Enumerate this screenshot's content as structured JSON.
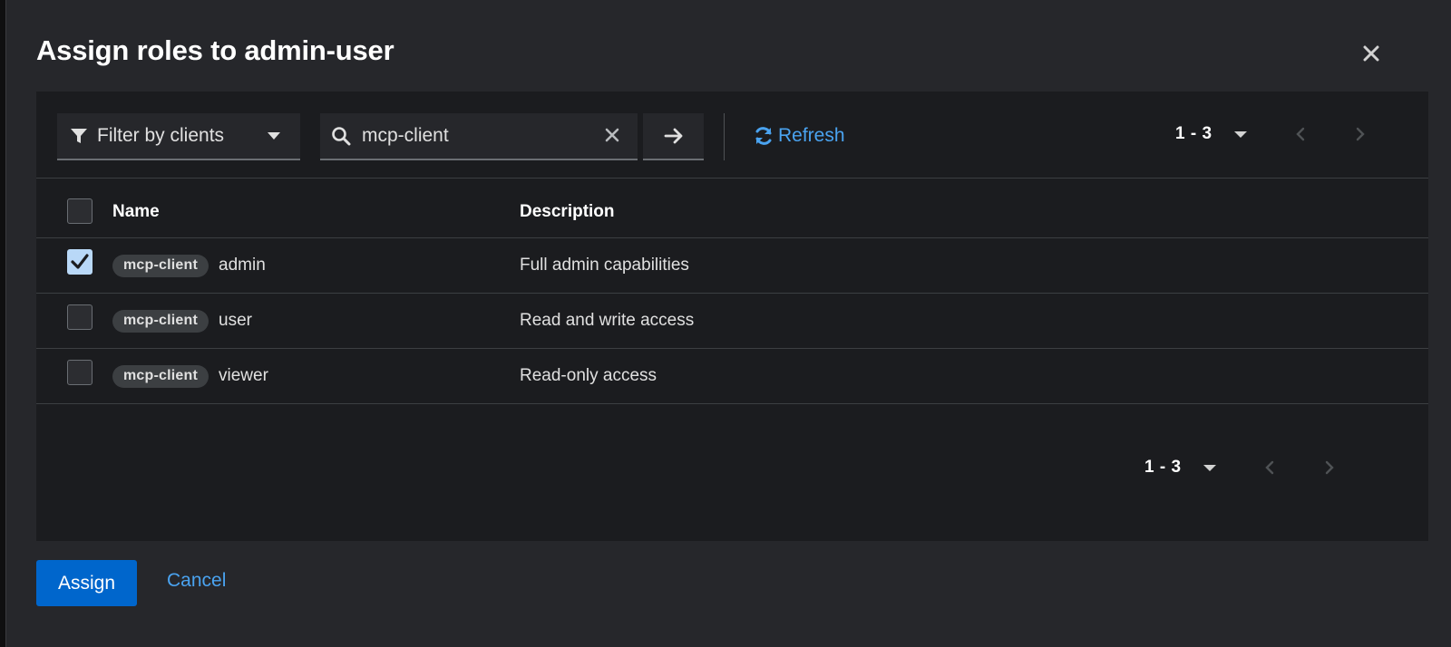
{
  "modal": {
    "title": "Assign roles to admin-user",
    "close_icon": "close-icon"
  },
  "toolbar": {
    "filter": {
      "label": "Filter by clients",
      "icon": "filter-icon"
    },
    "search": {
      "value": "mcp-client",
      "placeholder": "Search"
    },
    "refresh_label": "Refresh"
  },
  "pagination": {
    "top_range": "1 - 3",
    "bottom_range": "1 - 3"
  },
  "table": {
    "columns": [
      "Name",
      "Description"
    ],
    "rows": [
      {
        "client": "mcp-client",
        "role": "admin",
        "description": "Full admin capabilities",
        "checked": true
      },
      {
        "client": "mcp-client",
        "role": "user",
        "description": "Read and write access",
        "checked": false
      },
      {
        "client": "mcp-client",
        "role": "viewer",
        "description": "Read-only access",
        "checked": false
      }
    ]
  },
  "footer": {
    "assign_label": "Assign",
    "cancel_label": "Cancel"
  },
  "colors": {
    "modal_bg": "#26272b",
    "panel_bg": "#1b1c1f",
    "primary": "#0066cc",
    "link": "#4aa3f0",
    "checked_box": "#b9d8f7"
  }
}
